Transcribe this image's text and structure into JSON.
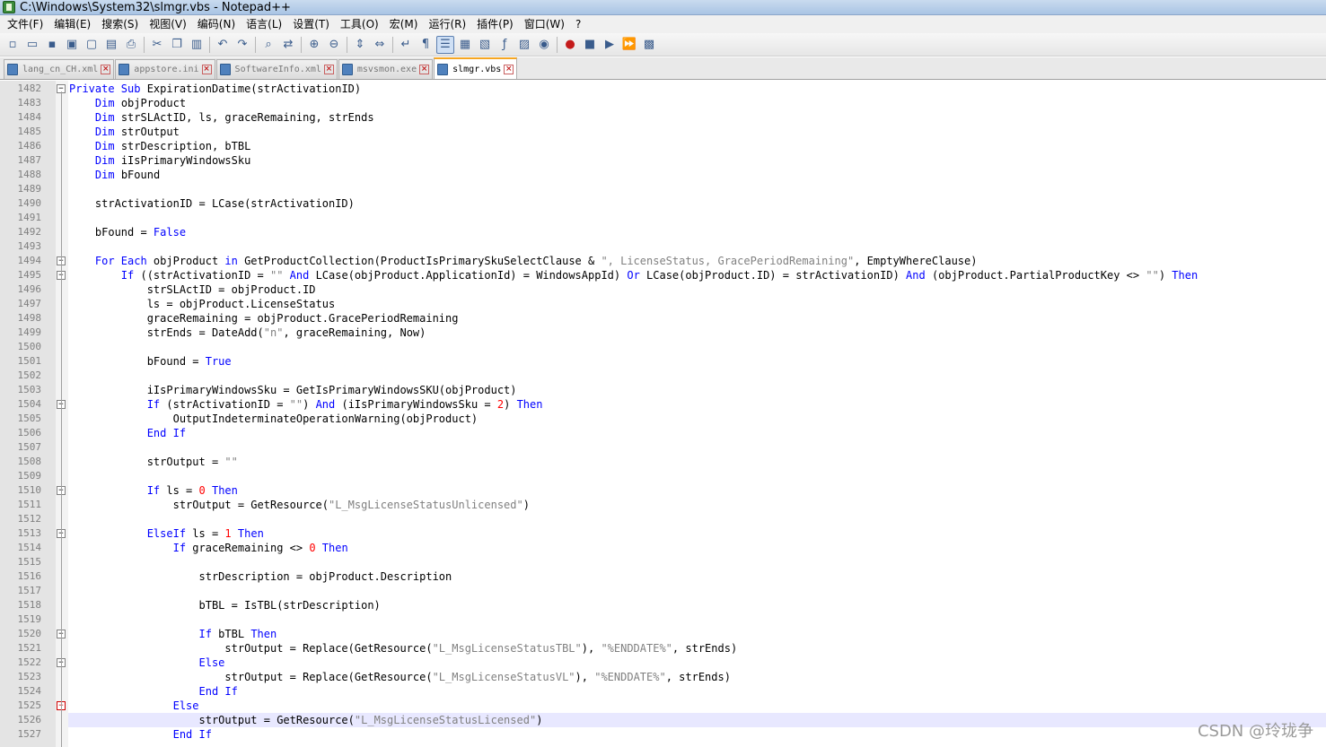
{
  "window": {
    "title": "C:\\Windows\\System32\\slmgr.vbs - Notepad++"
  },
  "menu": [
    "文件(F)",
    "编辑(E)",
    "搜索(S)",
    "视图(V)",
    "编码(N)",
    "语言(L)",
    "设置(T)",
    "工具(O)",
    "宏(M)",
    "运行(R)",
    "插件(P)",
    "窗口(W)",
    "?"
  ],
  "toolbar": [
    {
      "icon": "new-file-icon",
      "glyph": "▫"
    },
    {
      "icon": "open-file-icon",
      "glyph": "▭"
    },
    {
      "icon": "save-icon",
      "glyph": "▪"
    },
    {
      "icon": "save-all-icon",
      "glyph": "▣"
    },
    {
      "icon": "close-icon",
      "glyph": "▢"
    },
    {
      "icon": "close-all-icon",
      "glyph": "▤"
    },
    {
      "icon": "print-icon",
      "glyph": "⎙"
    },
    {
      "sep": true
    },
    {
      "icon": "cut-icon",
      "glyph": "✂"
    },
    {
      "icon": "copy-icon",
      "glyph": "❐"
    },
    {
      "icon": "paste-icon",
      "glyph": "▥"
    },
    {
      "sep": true
    },
    {
      "icon": "undo-icon",
      "glyph": "↶"
    },
    {
      "icon": "redo-icon",
      "glyph": "↷"
    },
    {
      "sep": true
    },
    {
      "icon": "find-icon",
      "glyph": "⌕"
    },
    {
      "icon": "replace-icon",
      "glyph": "⇄"
    },
    {
      "sep": true
    },
    {
      "icon": "zoom-in-icon",
      "glyph": "⊕"
    },
    {
      "icon": "zoom-out-icon",
      "glyph": "⊖"
    },
    {
      "sep": true
    },
    {
      "icon": "sync-vertical-icon",
      "glyph": "⇕"
    },
    {
      "icon": "sync-horizontal-icon",
      "glyph": "⇔"
    },
    {
      "sep": true
    },
    {
      "icon": "word-wrap-icon",
      "glyph": "↵"
    },
    {
      "icon": "show-all-chars-icon",
      "glyph": "¶"
    },
    {
      "icon": "indent-guide-icon",
      "glyph": "☰",
      "active": true
    },
    {
      "icon": "user-lang-icon",
      "glyph": "▦"
    },
    {
      "icon": "doc-map-icon",
      "glyph": "▧"
    },
    {
      "icon": "function-list-icon",
      "glyph": "ƒ"
    },
    {
      "icon": "folder-workspace-icon",
      "glyph": "▨"
    },
    {
      "icon": "monitor-icon",
      "glyph": "◉"
    },
    {
      "sep": true
    },
    {
      "icon": "record-macro-icon",
      "glyph": "●",
      "color": "red"
    },
    {
      "icon": "stop-macro-icon",
      "glyph": "■"
    },
    {
      "icon": "play-macro-icon",
      "glyph": "▶"
    },
    {
      "icon": "run-macro-multiple-icon",
      "glyph": "⏩"
    },
    {
      "icon": "save-macro-icon",
      "glyph": "▩"
    }
  ],
  "tabs": [
    {
      "name": "lang_cn_CH.xml",
      "active": false
    },
    {
      "name": "appstore.ini",
      "active": false
    },
    {
      "name": "SoftwareInfo.xml",
      "active": false
    },
    {
      "name": "msvsmon.exe",
      "active": false
    },
    {
      "name": "slmgr.vbs",
      "active": true
    }
  ],
  "colors": {
    "keyword": "#0000ff",
    "string": "#808080",
    "number": "#ff0000",
    "current_line": "#e8e8ff"
  },
  "editor": {
    "current_line": 1526,
    "lines": [
      {
        "n": "1482",
        "fold": "box",
        "segs": [
          [
            "kw",
            "Private Sub"
          ],
          [
            "t",
            " ExpirationDatime(strActivationID)"
          ]
        ]
      },
      {
        "n": "1483",
        "segs": [
          [
            "t",
            "    "
          ],
          [
            "kw",
            "Dim"
          ],
          [
            "t",
            " objProduct"
          ]
        ]
      },
      {
        "n": "1484",
        "segs": [
          [
            "t",
            "    "
          ],
          [
            "kw",
            "Dim"
          ],
          [
            "t",
            " strSLActID, ls, graceRemaining, strEnds"
          ]
        ]
      },
      {
        "n": "1485",
        "segs": [
          [
            "t",
            "    "
          ],
          [
            "kw",
            "Dim"
          ],
          [
            "t",
            " strOutput"
          ]
        ]
      },
      {
        "n": "1486",
        "segs": [
          [
            "t",
            "    "
          ],
          [
            "kw",
            "Dim"
          ],
          [
            "t",
            " strDescription, bTBL"
          ]
        ]
      },
      {
        "n": "1487",
        "segs": [
          [
            "t",
            "    "
          ],
          [
            "kw",
            "Dim"
          ],
          [
            "t",
            " iIsPrimaryWindowsSku"
          ]
        ]
      },
      {
        "n": "1488",
        "segs": [
          [
            "t",
            "    "
          ],
          [
            "kw",
            "Dim"
          ],
          [
            "t",
            " bFound"
          ]
        ]
      },
      {
        "n": "1489",
        "segs": []
      },
      {
        "n": "1490",
        "segs": [
          [
            "t",
            "    strActivationID = LCase(strActivationID)"
          ]
        ]
      },
      {
        "n": "1491",
        "segs": []
      },
      {
        "n": "1492",
        "segs": [
          [
            "t",
            "    bFound = "
          ],
          [
            "kw",
            "False"
          ]
        ]
      },
      {
        "n": "1493",
        "segs": []
      },
      {
        "n": "1494",
        "fold": "box",
        "segs": [
          [
            "t",
            "    "
          ],
          [
            "kw",
            "For Each"
          ],
          [
            "t",
            " objProduct "
          ],
          [
            "kw",
            "in"
          ],
          [
            "t",
            " GetProductCollection(ProductIsPrimarySkuSelectClause & "
          ],
          [
            "str",
            "\", LicenseStatus, GracePeriodRemaining\""
          ],
          [
            "t",
            ", EmptyWhereClause)"
          ]
        ]
      },
      {
        "n": "1495",
        "fold": "box",
        "segs": [
          [
            "t",
            "        "
          ],
          [
            "kw",
            "If"
          ],
          [
            "t",
            " ((strActivationID = "
          ],
          [
            "str",
            "\"\""
          ],
          [
            "t",
            " "
          ],
          [
            "kw",
            "And"
          ],
          [
            "t",
            " LCase(objProduct.ApplicationId) = WindowsAppId) "
          ],
          [
            "kw",
            "Or"
          ],
          [
            "t",
            " LCase(objProduct.ID) = strActivationID) "
          ],
          [
            "kw",
            "And"
          ],
          [
            "t",
            " (objProduct.PartialProductKey <> "
          ],
          [
            "str",
            "\"\""
          ],
          [
            "t",
            ") "
          ],
          [
            "kw",
            "Then"
          ]
        ]
      },
      {
        "n": "1496",
        "segs": [
          [
            "t",
            "            strSLActID = objProduct.ID"
          ]
        ]
      },
      {
        "n": "1497",
        "segs": [
          [
            "t",
            "            ls = objProduct.LicenseStatus"
          ]
        ]
      },
      {
        "n": "1498",
        "segs": [
          [
            "t",
            "            graceRemaining = objProduct.GracePeriodRemaining"
          ]
        ]
      },
      {
        "n": "1499",
        "segs": [
          [
            "t",
            "            strEnds = DateAdd("
          ],
          [
            "str",
            "\"n\""
          ],
          [
            "t",
            ", graceRemaining, Now)"
          ]
        ]
      },
      {
        "n": "1500",
        "segs": []
      },
      {
        "n": "1501",
        "segs": [
          [
            "t",
            "            bFound = "
          ],
          [
            "kw",
            "True"
          ]
        ]
      },
      {
        "n": "1502",
        "segs": []
      },
      {
        "n": "1503",
        "segs": [
          [
            "t",
            "            iIsPrimaryWindowsSku = GetIsPrimaryWindowsSKU(objProduct)"
          ]
        ]
      },
      {
        "n": "1504",
        "fold": "box",
        "segs": [
          [
            "t",
            "            "
          ],
          [
            "kw",
            "If"
          ],
          [
            "t",
            " (strActivationID = "
          ],
          [
            "str",
            "\"\""
          ],
          [
            "t",
            ") "
          ],
          [
            "kw",
            "And"
          ],
          [
            "t",
            " (iIsPrimaryWindowsSku = "
          ],
          [
            "num",
            "2"
          ],
          [
            "t",
            ") "
          ],
          [
            "kw",
            "Then"
          ]
        ]
      },
      {
        "n": "1505",
        "segs": [
          [
            "t",
            "                OutputIndeterminateOperationWarning(objProduct)"
          ]
        ]
      },
      {
        "n": "1506",
        "segs": [
          [
            "t",
            "            "
          ],
          [
            "kw",
            "End If"
          ]
        ]
      },
      {
        "n": "1507",
        "segs": []
      },
      {
        "n": "1508",
        "segs": [
          [
            "t",
            "            strOutput = "
          ],
          [
            "str",
            "\"\""
          ]
        ]
      },
      {
        "n": "1509",
        "segs": []
      },
      {
        "n": "1510",
        "fold": "box",
        "segs": [
          [
            "t",
            "            "
          ],
          [
            "kw",
            "If"
          ],
          [
            "t",
            " ls = "
          ],
          [
            "num",
            "0"
          ],
          [
            "t",
            " "
          ],
          [
            "kw",
            "Then"
          ]
        ]
      },
      {
        "n": "1511",
        "segs": [
          [
            "t",
            "                strOutput = GetResource("
          ],
          [
            "str",
            "\"L_MsgLicenseStatusUnlicensed\""
          ],
          [
            "t",
            ")"
          ]
        ]
      },
      {
        "n": "1512",
        "segs": []
      },
      {
        "n": "1513",
        "fold": "box",
        "segs": [
          [
            "t",
            "            "
          ],
          [
            "kw",
            "ElseIf"
          ],
          [
            "t",
            " ls = "
          ],
          [
            "num",
            "1"
          ],
          [
            "t",
            " "
          ],
          [
            "kw",
            "Then"
          ]
        ]
      },
      {
        "n": "1514",
        "segs": [
          [
            "t",
            "                "
          ],
          [
            "kw",
            "If"
          ],
          [
            "t",
            " graceRemaining <> "
          ],
          [
            "num",
            "0"
          ],
          [
            "t",
            " "
          ],
          [
            "kw",
            "Then"
          ]
        ]
      },
      {
        "n": "1515",
        "segs": []
      },
      {
        "n": "1516",
        "segs": [
          [
            "t",
            "                    strDescription = objProduct.Description"
          ]
        ]
      },
      {
        "n": "1517",
        "segs": []
      },
      {
        "n": "1518",
        "segs": [
          [
            "t",
            "                    bTBL = IsTBL(strDescription)"
          ]
        ]
      },
      {
        "n": "1519",
        "segs": []
      },
      {
        "n": "1520",
        "fold": "box",
        "segs": [
          [
            "t",
            "                    "
          ],
          [
            "kw",
            "If"
          ],
          [
            "t",
            " bTBL "
          ],
          [
            "kw",
            "Then"
          ]
        ]
      },
      {
        "n": "1521",
        "segs": [
          [
            "t",
            "                        strOutput = Replace(GetResource("
          ],
          [
            "str",
            "\"L_MsgLicenseStatusTBL\""
          ],
          [
            "t",
            "), "
          ],
          [
            "str",
            "\"%ENDDATE%\""
          ],
          [
            "t",
            ", strEnds)"
          ]
        ]
      },
      {
        "n": "1522",
        "fold": "box",
        "segs": [
          [
            "t",
            "                    "
          ],
          [
            "kw",
            "Else"
          ]
        ]
      },
      {
        "n": "1523",
        "segs": [
          [
            "t",
            "                        strOutput = Replace(GetResource("
          ],
          [
            "str",
            "\"L_MsgLicenseStatusVL\""
          ],
          [
            "t",
            "), "
          ],
          [
            "str",
            "\"%ENDDATE%\""
          ],
          [
            "t",
            ", strEnds)"
          ]
        ]
      },
      {
        "n": "1524",
        "segs": [
          [
            "t",
            "                    "
          ],
          [
            "kw",
            "End If"
          ]
        ]
      },
      {
        "n": "1525",
        "fold": "red",
        "segs": [
          [
            "t",
            "                "
          ],
          [
            "kw",
            "Else"
          ]
        ]
      },
      {
        "n": "1526",
        "segs": [
          [
            "t",
            "                    strOutput = GetResource("
          ],
          [
            "str",
            "\"L_MsgLicenseStatusLicensed\""
          ],
          [
            "t",
            ")"
          ]
        ]
      },
      {
        "n": "1527",
        "segs": [
          [
            "t",
            "                "
          ],
          [
            "kw",
            "End If"
          ]
        ]
      }
    ]
  },
  "watermark": "CSDN @玲珑争"
}
